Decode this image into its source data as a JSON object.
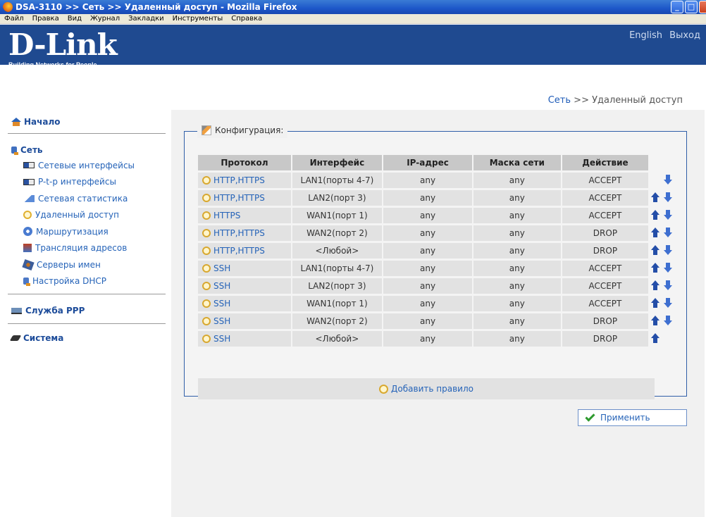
{
  "window": {
    "title": "DSA-3110 >> Сеть >> Удаленный доступ - Mozilla Firefox",
    "menu": [
      "Файл",
      "Правка",
      "Вид",
      "Журнал",
      "Закладки",
      "Инструменты",
      "Справка"
    ]
  },
  "header": {
    "brand": "D-Link",
    "tagline": "Building Networks for People",
    "lang_link": "English",
    "logout_link": "Выход"
  },
  "breadcrumb": {
    "section": "Сеть",
    "separator": ">>",
    "page": "Удаленный доступ"
  },
  "sidebar": {
    "home": "Начало",
    "network": "Сеть",
    "network_items": [
      "Сетевые интерфейсы",
      "P-t-p интерфейсы",
      "Сетевая статистика",
      "Удаленный доступ",
      "Маршрутизация",
      "Трансляция адресов",
      "Серверы имен",
      "Настройка DHCP"
    ],
    "ppp": "Служба PPP",
    "system": "Система"
  },
  "config": {
    "legend": "Конфигурация:",
    "columns": [
      "Протокол",
      "Интерфейс",
      "IP-адрес",
      "Маска сети",
      "Действие"
    ],
    "rows": [
      {
        "protocol": "HTTP,HTTPS",
        "interface": "LAN1(порты 4-7)",
        "ip": "any",
        "mask": "any",
        "action": "ACCEPT",
        "up": false,
        "down": true
      },
      {
        "protocol": "HTTP,HTTPS",
        "interface": "LAN2(порт 3)",
        "ip": "any",
        "mask": "any",
        "action": "ACCEPT",
        "up": true,
        "down": true
      },
      {
        "protocol": "HTTPS",
        "interface": "WAN1(порт 1)",
        "ip": "any",
        "mask": "any",
        "action": "ACCEPT",
        "up": true,
        "down": true
      },
      {
        "protocol": "HTTP,HTTPS",
        "interface": "WAN2(порт 2)",
        "ip": "any",
        "mask": "any",
        "action": "DROP",
        "up": true,
        "down": true
      },
      {
        "protocol": "HTTP,HTTPS",
        "interface": "<Любой>",
        "ip": "any",
        "mask": "any",
        "action": "DROP",
        "up": true,
        "down": true
      },
      {
        "protocol": "SSH",
        "interface": "LAN1(порты 4-7)",
        "ip": "any",
        "mask": "any",
        "action": "ACCEPT",
        "up": true,
        "down": true
      },
      {
        "protocol": "SSH",
        "interface": "LAN2(порт 3)",
        "ip": "any",
        "mask": "any",
        "action": "ACCEPT",
        "up": true,
        "down": true
      },
      {
        "protocol": "SSH",
        "interface": "WAN1(порт 1)",
        "ip": "any",
        "mask": "any",
        "action": "ACCEPT",
        "up": true,
        "down": true
      },
      {
        "protocol": "SSH",
        "interface": "WAN2(порт 2)",
        "ip": "any",
        "mask": "any",
        "action": "DROP",
        "up": true,
        "down": true
      },
      {
        "protocol": "SSH",
        "interface": "<Любой>",
        "ip": "any",
        "mask": "any",
        "action": "DROP",
        "up": true,
        "down": false
      }
    ],
    "add_rule": "Добавить правило"
  },
  "apply_label": "Применить",
  "colors": {
    "header_bg": "#1f4a90",
    "link": "#2563b8",
    "panel_border": "#2f5ea8"
  }
}
